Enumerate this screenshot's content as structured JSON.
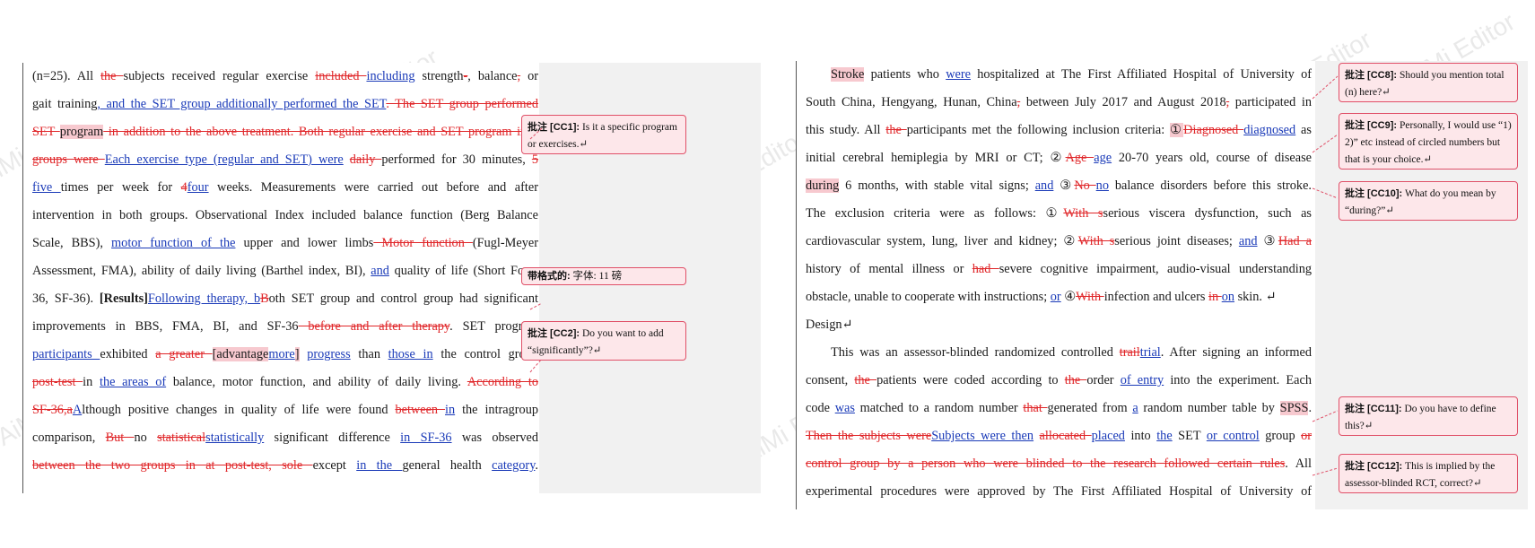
{
  "watermark": "AiMi Editor",
  "left": {
    "lines": [
      [
        "(n=25). All ",
        {
          "d": "the "
        },
        "subjects received regular exercise ",
        {
          "d": "included "
        },
        {
          "i": "including"
        },
        " strength",
        {
          "d": "-"
        },
        ", balance",
        {
          "d": ","
        },
        " or"
      ],
      [
        "gait training",
        {
          "i": ", and the SET group additionally performed the SET"
        },
        {
          "d": ". The SET group performed"
        }
      ],
      [
        {
          "d": "SET "
        },
        {
          "h": "program"
        },
        {
          "d": " in addition to the above treatment. Both regular exercise and SET program in 2"
        }
      ],
      [
        {
          "d": "groups were "
        },
        {
          "i": "Each exercise type (regular and SET) were"
        },
        " ",
        {
          "d": "daily "
        },
        "performed for 30 minutes, ",
        {
          "d": "5"
        }
      ],
      [
        {
          "i": "five "
        },
        " times per week for ",
        {
          "d": "4"
        },
        {
          "i": "four"
        },
        " weeks. Measurements were carried out before and after"
      ],
      [
        "intervention in both groups. Observational Index included balance function (Berg Balance"
      ],
      [
        "Scale, BBS), ",
        {
          "i": "motor function of the"
        },
        " upper and lower limbs",
        {
          "d": " Motor function "
        },
        "(Fugl-Meyer"
      ],
      [
        "Assessment, FMA), ability of daily living (Barthel index, BI), ",
        {
          "i": "and"
        },
        " quality of life (Short Form"
      ],
      [
        "36, SF-36). ",
        {
          "b": "[Results]"
        },
        {
          "i": "Following therapy, b"
        },
        {
          "d": "B"
        },
        "oth SET group and control group had significant"
      ],
      [
        "improvements in BBS, FMA, BI, and SF-36",
        {
          "d": " before and after therapy"
        },
        ". SET program"
      ],
      [
        {
          "i": "participants "
        },
        " exhibited ",
        {
          "d": "a greater "
        },
        {
          "h": "[advantage"
        },
        {
          "i": "more"
        },
        {
          "h": "]"
        },
        " ",
        {
          "i": "progress"
        },
        " than ",
        {
          "i": "those in"
        },
        " the control group"
      ],
      [
        {
          "d": "post-test "
        },
        "in ",
        {
          "i": "the areas of"
        },
        " balance, motor function, and ability of daily living. ",
        {
          "d": "According to"
        }
      ],
      [
        {
          "d": "SF-36,a"
        },
        {
          "i": "A"
        },
        "lthough positive changes in quality of life were found ",
        {
          "d": "between "
        },
        {
          "i": "in"
        },
        " the intragroup"
      ],
      [
        "comparison, ",
        {
          "d": "But "
        },
        "no ",
        {
          "d": "statistical"
        },
        {
          "i": "statistically"
        },
        " significant difference ",
        {
          "i": "in SF-36"
        },
        " was observed"
      ],
      [
        {
          "d": "between the two groups in at post-test, sole "
        },
        "except ",
        {
          "i": "in the "
        },
        " general health ",
        {
          "i": "category"
        },
        "."
      ]
    ],
    "comments": [
      {
        "tag": "批注 [CC1]:",
        "text": "Is it a specific program or exercises.↵"
      },
      {
        "tag": "带格式的:",
        "text": "字体: 11 磅"
      },
      {
        "tag": "批注 [CC2]:",
        "text": "Do you want to add “significantly”?↵"
      }
    ]
  },
  "right": {
    "paras": [
      {
        "indent": true,
        "lines": [
          [
            {
              "h": "Stroke"
            },
            " patients who ",
            {
              "i": "were"
            },
            " hospitalized at The First Affiliated Hospital of University of"
          ],
          [
            "South China, Hengyang, Hunan, China",
            {
              "d": ","
            },
            " between July 2017 and August 2018",
            {
              "d": ","
            },
            " participated in"
          ],
          [
            "this study. All ",
            {
              "d": "the "
            },
            "participants met the following inclusion criteria: ",
            {
              "h": "①"
            },
            {
              "d": "Diagnosed "
            },
            {
              "i": "diagnosed"
            },
            " as"
          ],
          [
            "initial cerebral hemiplegia by MRI or CT; ②",
            {
              "d": "Age "
            },
            {
              "i": "age"
            },
            " 20-70 years old, course of disease"
          ],
          [
            {
              "h": "during"
            },
            " 6 months, with stable vital signs; ",
            {
              "i": "and"
            },
            " ③",
            {
              "d": "No "
            },
            {
              "i": "no"
            },
            " balance disorders before this stroke."
          ],
          [
            "The exclusion criteria were as follows: ①",
            {
              "d": "With s"
            },
            "serious viscera dysfunction, such as"
          ],
          [
            "cardiovascular system, lung, liver and kidney; ②",
            {
              "d": "With s"
            },
            "serious joint diseases; ",
            {
              "i": "and"
            },
            " ③",
            {
              "d": "Had a"
            }
          ],
          [
            "history of mental illness or ",
            {
              "d": "had "
            },
            "severe cognitive impairment, audio-visual understanding"
          ],
          [
            "obstacle, unable to cooperate with instructions; ",
            {
              "i": "or"
            },
            " ④",
            {
              "d": "With "
            },
            "infection and ulcers ",
            {
              "d": "in "
            },
            {
              "i": "on"
            },
            " skin. ↵"
          ]
        ]
      },
      {
        "indent": false,
        "lines": [
          [
            "Design↵"
          ]
        ]
      },
      {
        "indent": true,
        "lines": [
          [
            "This was an assessor-blinded randomized controlled ",
            {
              "d": "trail"
            },
            {
              "i": "trial"
            },
            ". After signing an informed"
          ],
          [
            "consent, ",
            {
              "d": "the "
            },
            "patients were coded according to ",
            {
              "d": "the "
            },
            "order ",
            {
              "i": "of entry"
            },
            " into the experiment. Each"
          ],
          [
            "code ",
            {
              "i": "was"
            },
            " matched to a random number ",
            {
              "d": "that "
            },
            "generated from ",
            {
              "i": "a"
            },
            " random number table by ",
            {
              "h": "SPSS"
            },
            "."
          ],
          [
            {
              "d": "Then the subjects were"
            },
            {
              "i": "Subjects were then"
            },
            " ",
            {
              "d": "allocated "
            },
            {
              "i": "placed"
            },
            " into ",
            {
              "i": "the"
            },
            " SET ",
            {
              "i": "or control"
            },
            " group ",
            {
              "d": "or"
            }
          ],
          [
            {
              "d": "control group by a person who were blinded to the research followed certain rules"
            },
            ". All"
          ],
          [
            "experimental procedures were approved by The First Affiliated Hospital of University of"
          ]
        ]
      }
    ],
    "comments": [
      {
        "tag": "批注 [CC8]:",
        "text": "Should you mention total (n) here?↵"
      },
      {
        "tag": "批注 [CC9]:",
        "text": "Personally, I would use “1) 2)” etc instead of circled numbers but that is your choice.↵"
      },
      {
        "tag": "批注 [CC10]:",
        "text": "What do you mean by “during?”↵"
      },
      {
        "tag": "批注 [CC11]:",
        "text": "Do you have to define this?↵"
      },
      {
        "tag": "批注 [CC12]:",
        "text": "This is implied by the assessor-blinded RCT, correct?↵"
      }
    ]
  }
}
